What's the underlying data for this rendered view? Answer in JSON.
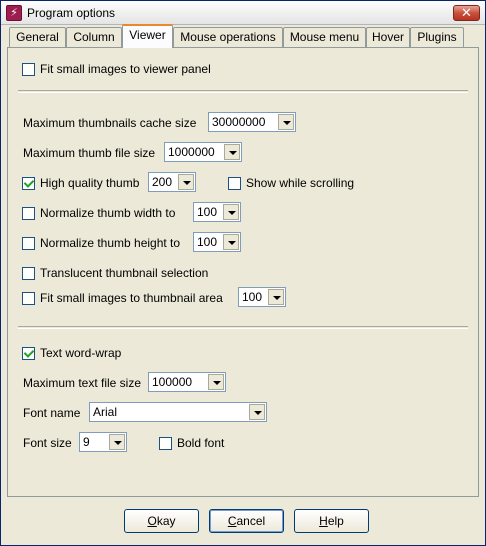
{
  "window": {
    "title": "Program options"
  },
  "tabs": [
    {
      "label": "General"
    },
    {
      "label": "Column"
    },
    {
      "label": "Viewer",
      "active": true
    },
    {
      "label": "Mouse operations"
    },
    {
      "label": "Mouse menu"
    },
    {
      "label": "Hover"
    },
    {
      "label": "Plugins"
    }
  ],
  "viewer": {
    "fit_viewer": {
      "label": "Fit small images to viewer panel",
      "checked": false
    },
    "cache_size": {
      "label": "Maximum thumbnails cache size",
      "value": "30000000"
    },
    "thumb_file_size": {
      "label": "Maximum thumb file size",
      "value": "1000000"
    },
    "high_quality": {
      "label": "High quality thumb",
      "checked": true,
      "value": "200"
    },
    "show_scrolling": {
      "label": "Show while scrolling",
      "checked": false
    },
    "norm_width": {
      "label": "Normalize thumb width to",
      "checked": false,
      "value": "100"
    },
    "norm_height": {
      "label": "Normalize thumb height to",
      "checked": false,
      "value": "100"
    },
    "translucent": {
      "label": "Translucent thumbnail selection",
      "checked": false
    },
    "fit_thumb": {
      "label": "Fit small images to thumbnail area",
      "checked": false,
      "value": "100"
    },
    "word_wrap": {
      "label": "Text word-wrap",
      "checked": true
    },
    "text_size": {
      "label": "Maximum text file size",
      "value": "100000"
    },
    "font_name": {
      "label": "Font name",
      "value": "Arial"
    },
    "font_size": {
      "label": "Font size",
      "value": "9"
    },
    "bold_font": {
      "label": "Bold font",
      "checked": false
    }
  },
  "buttons": {
    "okay": {
      "pre": "",
      "key": "O",
      "post": "kay"
    },
    "cancel": {
      "pre": "",
      "key": "C",
      "post": "ancel"
    },
    "help": {
      "pre": "",
      "key": "H",
      "post": "elp"
    }
  },
  "colors": {
    "title_gradient_top": "#fdfdfd",
    "close_red": "#c9513c",
    "tab_highlight": "#e68b2c",
    "dialog_bg": "#ece9d8"
  }
}
